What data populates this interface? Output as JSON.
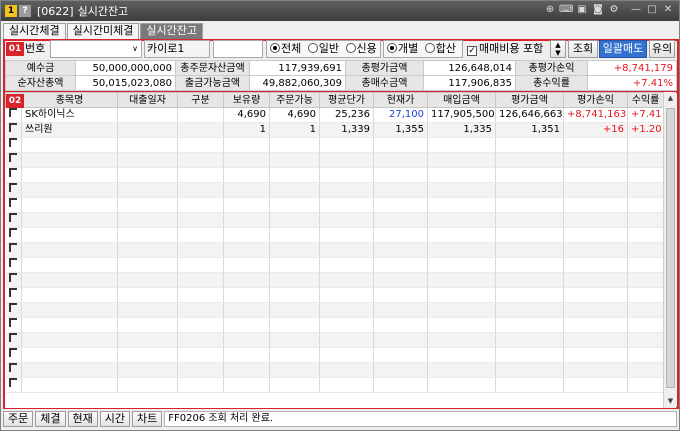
{
  "window": {
    "code": "[0622]",
    "title": "실시간잔고",
    "icons": [
      "pin-icon",
      "keyboard-icon",
      "save-icon",
      "camera-icon",
      "gear-icon",
      "minimize-icon",
      "maximize-icon",
      "close-icon"
    ]
  },
  "tabs": [
    {
      "label": "실시간체결",
      "active": false
    },
    {
      "label": "실시간미체결",
      "active": false
    },
    {
      "label": "실시간잔고",
      "active": true
    }
  ],
  "section1": {
    "badge": "01",
    "account_label": "번호",
    "account_value": "",
    "name_value": "카이로1",
    "password_value": "",
    "radio_group1": [
      {
        "label": "전체",
        "checked": true
      },
      {
        "label": "일반",
        "checked": false
      },
      {
        "label": "신용",
        "checked": false
      }
    ],
    "radio_group2": [
      {
        "label": "개별",
        "checked": true
      },
      {
        "label": "합산",
        "checked": false
      }
    ],
    "include_fee": {
      "label": "매매비용 포함",
      "checked": true
    },
    "query_button": "조회",
    "sell_all_button": "일괄매도",
    "note_button": "유의"
  },
  "summary": [
    [
      {
        "label": "예수금",
        "value": "50,000,000,000",
        "color": ""
      },
      {
        "label": "총주문자산금액",
        "value": "117,939,691",
        "color": ""
      },
      {
        "label": "총평가금액",
        "value": "126,648,014",
        "color": ""
      },
      {
        "label": "총평가손익",
        "value": "+8,741,179",
        "color": "red"
      }
    ],
    [
      {
        "label": "순자산총액",
        "value": "50,015,023,080",
        "color": ""
      },
      {
        "label": "출금가능금액",
        "value": "49,882,060,309",
        "color": ""
      },
      {
        "label": "총매수금액",
        "value": "117,906,835",
        "color": ""
      },
      {
        "label": "총수익률",
        "value": "+7.41%",
        "color": "red"
      }
    ]
  ],
  "section2": {
    "badge": "02"
  },
  "grid": {
    "columns": [
      "종목명",
      "대출일자",
      "구분",
      "보유량",
      "주문가능",
      "평균단가",
      "현재가",
      "매입금액",
      "평가금액",
      "평가손익",
      "수익률"
    ],
    "rows": [
      {
        "name": "SK하이닉스",
        "loan_date": "",
        "type": "",
        "qty": "4,690",
        "orderable": "4,690",
        "avg_price": "25,236",
        "cur_price": "27,100",
        "cur_color": "blue",
        "buy_amt": "117,905,500",
        "eval_amt": "126,646,663",
        "pnl": "+8,741,163",
        "ret": "+7.41"
      },
      {
        "name": "쓰리원",
        "loan_date": "",
        "type": "",
        "qty": "1",
        "orderable": "1",
        "avg_price": "1,339",
        "cur_price": "1,355",
        "cur_color": "",
        "buy_amt": "1,335",
        "eval_amt": "1,351",
        "pnl": "+16",
        "ret": "+1.20"
      }
    ],
    "empty_rows": 17
  },
  "statusbar": {
    "buttons": [
      "주문",
      "체결",
      "현재",
      "시간",
      "차트"
    ],
    "message": "FF0206 조회 처리 완료."
  }
}
